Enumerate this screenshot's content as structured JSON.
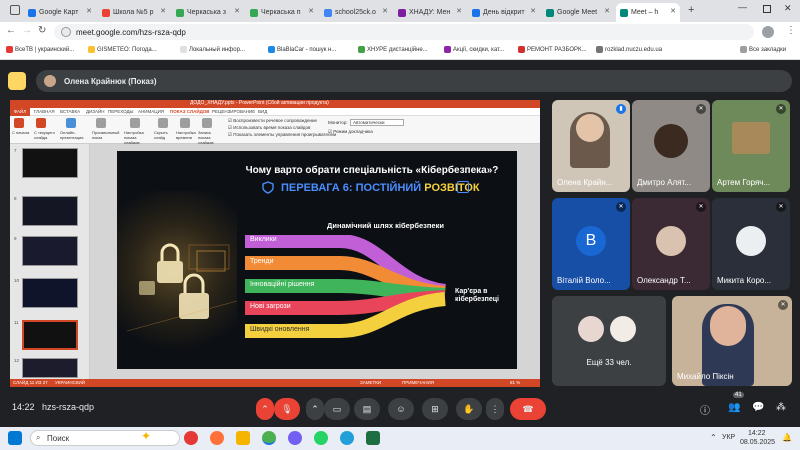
{
  "browser": {
    "tabs": [
      {
        "label": "Google Карт",
        "color": "#1a73e8"
      },
      {
        "label": "Школа №5 р",
        "color": "#ea4335"
      },
      {
        "label": "Черкаська з",
        "color": "#34a853"
      },
      {
        "label": "Черкаська п",
        "color": "#34a853"
      },
      {
        "label": "school25ck.o",
        "color": "#4285f4"
      },
      {
        "label": "ХНАДУ: Мен",
        "color": "#7b1fa2"
      },
      {
        "label": "День відкрит",
        "color": "#1a73e8"
      },
      {
        "label": "Google Meet",
        "color": "#00897b"
      },
      {
        "label": "Meet – h",
        "color": "#00897b"
      }
    ],
    "url": "meet.google.com/hzs-rsza-qdp",
    "bookmarks": [
      "ВсеТВ | украинский...",
      "GISMETEO: Погода...",
      "Локальный инфор...",
      "BlaBlaCar - пошук н...",
      "ХНУРЕ дистанційне...",
      "Акції, скидки, кат...",
      "РЕМОНТ РАЗБОРК...",
      "rozklad.nuczu.edu.ua"
    ],
    "all_bookmarks": "Все закладки"
  },
  "meet": {
    "presenter": "Олена Крайнюк (Показ)",
    "meeting_code": "hzs-rsza-qdp",
    "time": "14:22",
    "participants_count": "41",
    "more_people": "Ещё 33 чел.",
    "tiles": [
      {
        "name": "Олена Крайн...",
        "type": "video",
        "avatar_color": "#8d6e63"
      },
      {
        "name": "Дмитро Алят...",
        "type": "video",
        "avatar_color": "#5d4037"
      },
      {
        "name": "Артем Горяч...",
        "type": "video",
        "avatar_color": "#6d8b3a"
      },
      {
        "name": "Віталій Воло...",
        "type": "letter",
        "letter": "В",
        "avatar_color": "#1967d2"
      },
      {
        "name": "Олександр Т...",
        "type": "avatar",
        "avatar_color": "#e53935"
      },
      {
        "name": "Микита Коро...",
        "type": "avatar",
        "avatar_color": "#263238"
      },
      {
        "name": "Михайло Піксін",
        "type": "video",
        "avatar_color": "#bfa58a"
      }
    ]
  },
  "ppt": {
    "title_bar": "ДОДО_ХНАДУ.pptx - PowerPoint (Сбой активации продукта)",
    "ribbon_tabs": [
      "ФАЙЛ",
      "ГЛАВНАЯ",
      "ВСТАВКА",
      "ДИЗАЙН",
      "ПЕРЕХОДЫ",
      "АНИМАЦИЯ",
      "ПОКАЗ СЛАЙДОВ",
      "РЕЦЕНЗИРОВАНИЕ",
      "ВИД"
    ],
    "ribbon_groups": [
      "С начала",
      "С текущего слайда",
      "Онлайн-презентация",
      "Произвольный показ",
      "Настройка показа слайдов",
      "Скрыть слайд",
      "Настройка времени",
      "Запись показа слайдов"
    ],
    "checkboxes": [
      "Воспроизвести речевое сопровождение",
      "Использовать время показа слайдов",
      "Показать элементы управления проигрывателем"
    ],
    "monitor_label": "Монитор:",
    "monitor_value": "Автоматически",
    "presenter_view": "Режим докладчика",
    "thumb_numbers": [
      "7",
      "8",
      "9",
      "10",
      "11",
      "12"
    ],
    "status_left": "СЛАЙД 11 ИЗ 27",
    "status_lang": "УКРАИНСКИЙ",
    "status_notes": "ЗАМЕТКИ",
    "status_comments": "ПРИМЕЧАНИЯ",
    "zoom": "81 %"
  },
  "slide": {
    "title": "Чому варто обрати спеціальність «Кібербезпека»?",
    "subtitle_prefix": "ПЕРЕВАГА 6: ПОСТІЙНИЙ ",
    "subtitle_highlight": "РОЗВІТОК",
    "diagram_title": "Динамічний шлях кібербезпеки",
    "branches": [
      {
        "label": "Виклики",
        "color": "#c05fd6"
      },
      {
        "label": "Тренди",
        "color": "#f28b36"
      },
      {
        "label": "Інноваційні рішення",
        "color": "#3fb45a"
      },
      {
        "label": "Нові загрози",
        "color": "#e8455a"
      },
      {
        "label": "Швидкі оновлення",
        "color": "#f4d03f"
      }
    ],
    "target": "Кар'єра в кібербезпеці"
  },
  "taskbar": {
    "search": "Поиск",
    "lang": "УКР",
    "time": "14:22",
    "date": "08.05.2025"
  }
}
